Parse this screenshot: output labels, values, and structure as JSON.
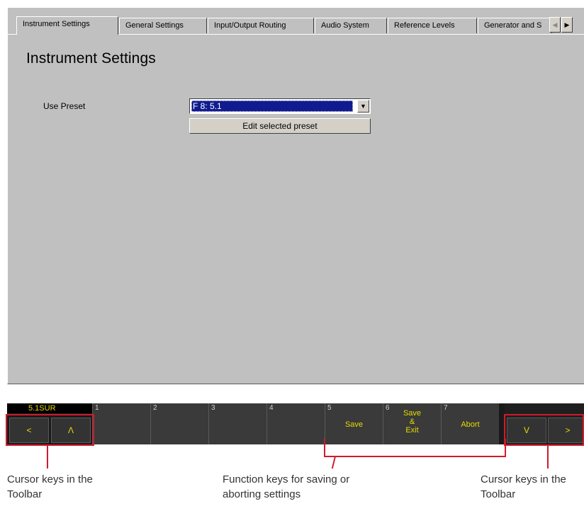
{
  "tabs": [
    {
      "label": "Instrument Settings"
    },
    {
      "label": "General Settings"
    },
    {
      "label": "Input/Output Routing"
    },
    {
      "label": "Audio System"
    },
    {
      "label": "Reference Levels"
    },
    {
      "label": "Generator and S"
    }
  ],
  "tab_scroll": {
    "left_icon": "scroll-left-icon",
    "right_icon": "scroll-right-icon"
  },
  "page": {
    "title": "Instrument Settings",
    "use_preset_label": "Use Preset",
    "preset_value": "F 8: 5.1",
    "edit_button": "Edit selected preset"
  },
  "toolbar": {
    "preset_badge": "5.1SUR",
    "fkeys": [
      {
        "num": "1",
        "label": ""
      },
      {
        "num": "2",
        "label": ""
      },
      {
        "num": "3",
        "label": ""
      },
      {
        "num": "4",
        "label": ""
      },
      {
        "num": "5",
        "label": "Save"
      },
      {
        "num": "6",
        "label": "Save & Exit",
        "line1": "Save",
        "line2": "&",
        "line3": "Exit"
      },
      {
        "num": "7",
        "label": "Abort"
      }
    ],
    "cursor_left": "<",
    "cursor_up": "Λ",
    "cursor_down": "V",
    "cursor_right": ">"
  },
  "annotations": {
    "left": {
      "line1": "Cursor keys in the",
      "line2": "Toolbar"
    },
    "middle": {
      "line1": "Function keys for saving or",
      "line2": "aborting settings"
    },
    "right": {
      "line1": "Cursor keys in the",
      "line2": "Toolbar"
    }
  },
  "colors": {
    "window": "#c0c0c0",
    "selection": "#101b8f",
    "toolbar_text": "#e8dc00",
    "annotation": "#d11a2a"
  }
}
